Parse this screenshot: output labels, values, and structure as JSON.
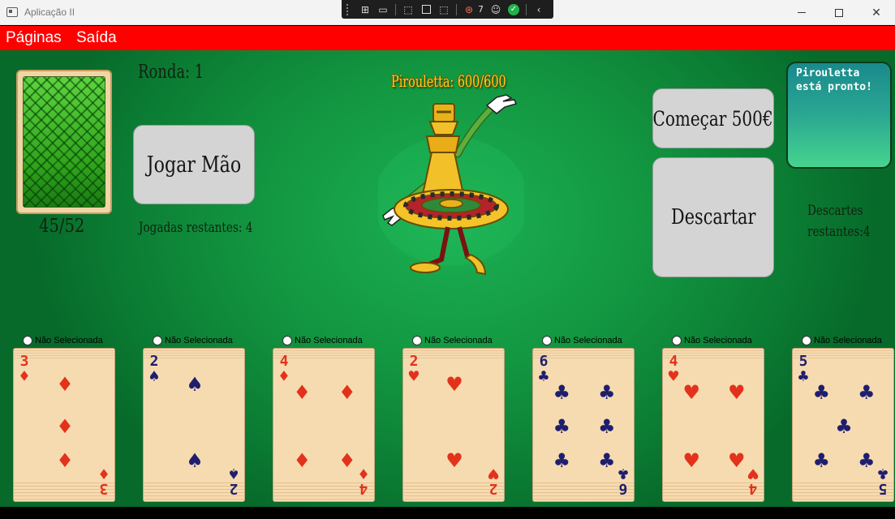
{
  "window": {
    "title": "Aplicação II",
    "devtools_badge": "7"
  },
  "menu": {
    "items": [
      "Páginas",
      "Saída"
    ]
  },
  "deck": {
    "count_label": "45/52"
  },
  "round": {
    "label": "Ronda: 1"
  },
  "buttons": {
    "play_hand": "Jogar Mão",
    "start": "Começar 500€",
    "discard": "Descartar"
  },
  "plays_remaining": "Jogadas restantes: 4",
  "boss": {
    "name_label": "Pirouletta: 600/600"
  },
  "status_message": "Pirouletta está pronto!",
  "discards_remaining": {
    "line1": "Descartes",
    "line2": "restantes:4"
  },
  "colors": {
    "menu_bar": "#ff0000",
    "table_green": "#139741",
    "red_suit": "#e3321c",
    "dark_suit": "#1f1e6e"
  },
  "hand": [
    {
      "selection_label": "Não Selecionada",
      "rank": "3",
      "suit": "diamonds"
    },
    {
      "selection_label": "Não Selecionada",
      "rank": "2",
      "suit": "spades"
    },
    {
      "selection_label": "Não Selecionada",
      "rank": "4",
      "suit": "diamonds"
    },
    {
      "selection_label": "Não Selecionada",
      "rank": "2",
      "suit": "hearts"
    },
    {
      "selection_label": "Não Selecionada",
      "rank": "6",
      "suit": "clubs"
    },
    {
      "selection_label": "Não Selecionada",
      "rank": "4",
      "suit": "hearts"
    },
    {
      "selection_label": "Não Selecionada",
      "rank": "5",
      "suit": "clubs"
    }
  ]
}
